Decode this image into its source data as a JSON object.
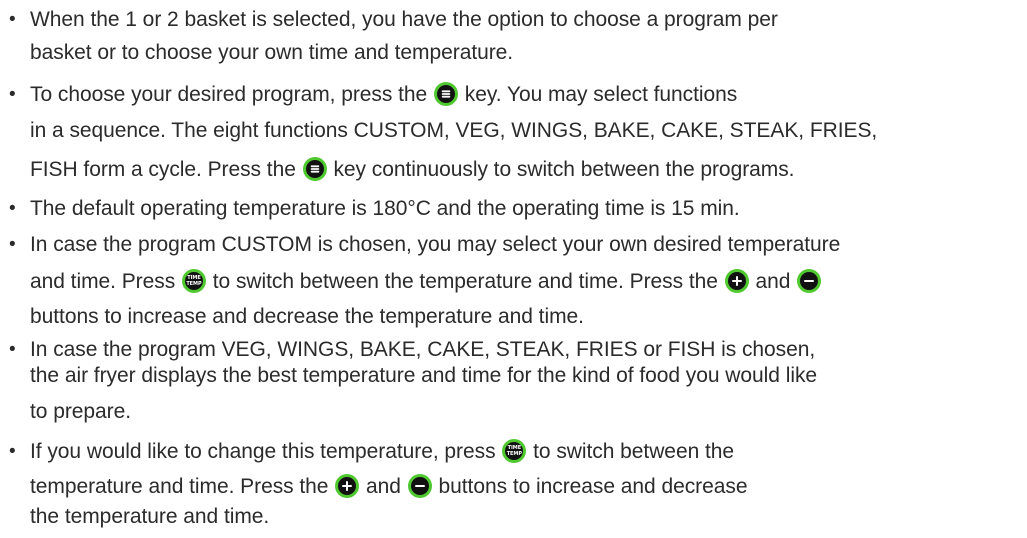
{
  "lines": [
    {
      "a": "When the 1 or 2 basket is selected, you have the option to choose a program per"
    },
    {
      "a": "basket or to choose your own time and temperature."
    },
    {
      "a": "To choose your desired program, press the",
      "b": "key. You may select functions"
    },
    {
      "a": "in a sequence. The eight functions CUSTOM, VEG, WINGS, BAKE, CAKE, STEAK, FRIES,"
    },
    {
      "a": "FISH form a cycle. Press the",
      "b": "key continuously to switch between the programs."
    },
    {
      "a": "The default operating temperature is 180°C and the operating time is 15 min."
    },
    {
      "a": "In case the program CUSTOM is chosen, you may select your own desired temperature"
    },
    {
      "a": "and time. Press",
      "b": "to switch between the temperature and time. Press the",
      "c": "and"
    },
    {
      "a": "buttons to increase and decrease the temperature and time."
    },
    {
      "a": "In case the program VEG, WINGS, BAKE, CAKE, STEAK, FRIES or FISH is chosen,"
    },
    {
      "a": "the air fryer displays the best temperature and time for the kind of food you would like"
    },
    {
      "a": "to prepare."
    },
    {
      "a": "If you would like to change this temperature, press",
      "b": "to switch between the"
    },
    {
      "a": "temperature and time. Press the",
      "b": "and",
      "c": "buttons to increase and decrease"
    },
    {
      "a": "the temperature and time."
    }
  ],
  "icons": {
    "time_temp_label_1": "TIME",
    "time_temp_label_2": "TEMP",
    "accent_color": "#50c830",
    "icon_fill_color": "#111111",
    "menu": "menu-icon",
    "time_temp": "time-temp-icon",
    "plus": "plus-icon",
    "minus": "minus-icon"
  }
}
